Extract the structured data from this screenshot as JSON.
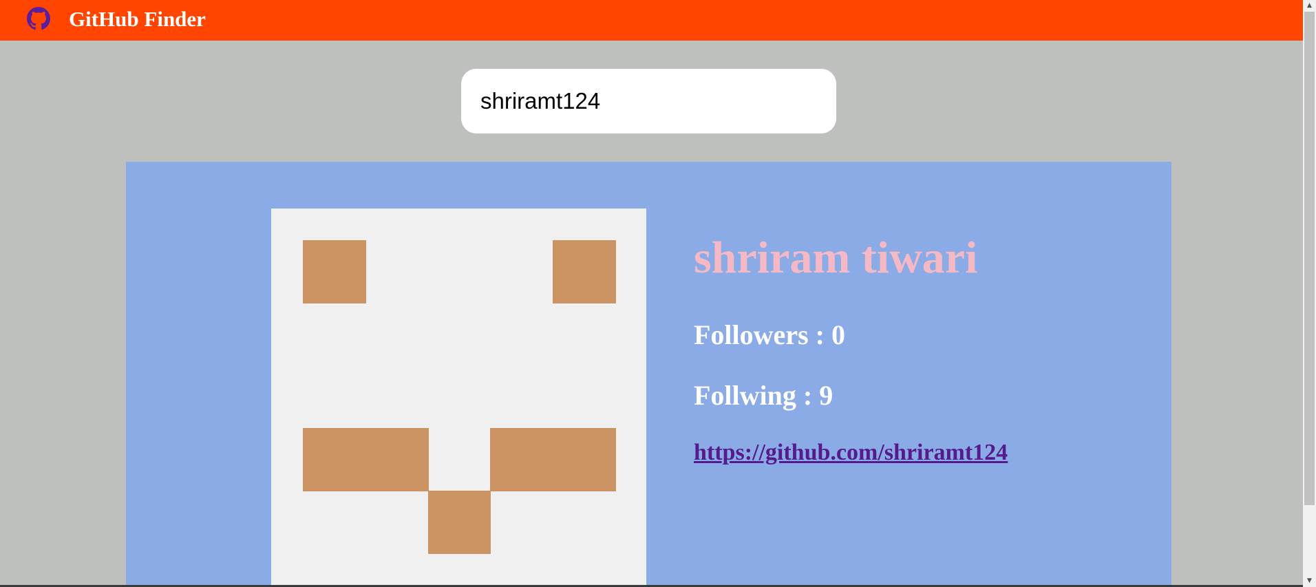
{
  "navbar": {
    "title": "GitHub Finder",
    "logo_icon": "github-icon",
    "background": "#ff4500"
  },
  "search": {
    "value": "shriramt124"
  },
  "profile": {
    "name": "shriram tiwari",
    "followers_text": "Followers : 0",
    "following_text": "Follwing : 9",
    "url": "https://github.com/shriramt124",
    "card_color": "#8aabe5",
    "name_color": "#f4b9c4",
    "avatar": {
      "pattern_color": "#cc9463",
      "background": "#f0f0f0"
    }
  }
}
